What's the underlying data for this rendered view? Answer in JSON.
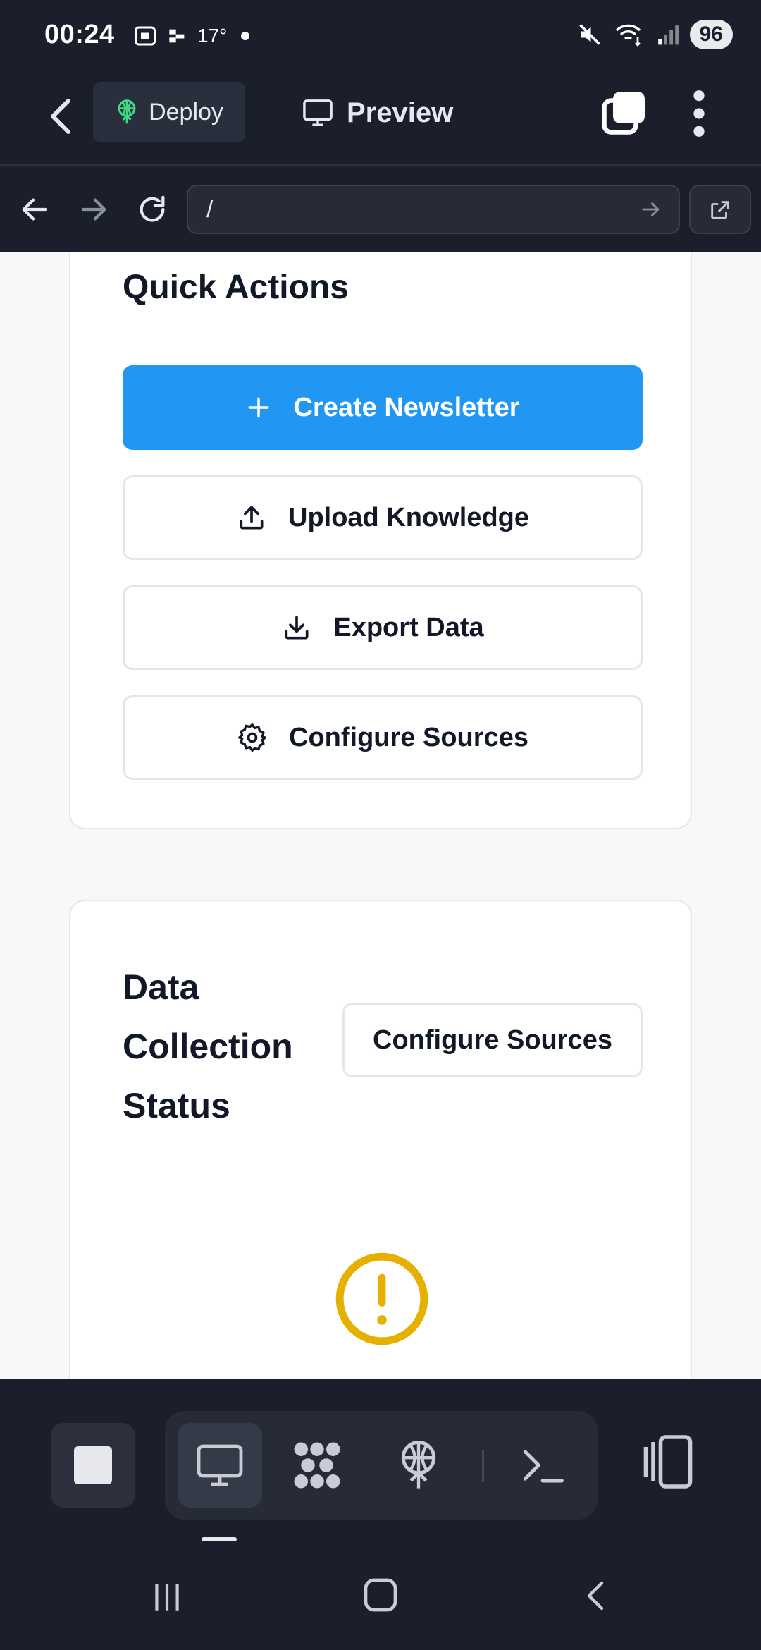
{
  "status_bar": {
    "time": "00:24",
    "temperature": "17°",
    "battery": "96"
  },
  "toolbar": {
    "deploy_label": "Deploy",
    "preview_label": "Preview"
  },
  "url_bar": {
    "value": "/"
  },
  "quick_actions": {
    "title": "Quick Actions",
    "buttons": [
      {
        "label": "Create Newsletter",
        "icon": "plus-icon"
      },
      {
        "label": "Upload Knowledge",
        "icon": "upload-icon"
      },
      {
        "label": "Export Data",
        "icon": "download-icon"
      },
      {
        "label": "Configure Sources",
        "icon": "gear-icon"
      }
    ]
  },
  "data_collection": {
    "title": "Data Collection Status",
    "configure_label": "Configure Sources",
    "status_icon": "warning-icon"
  },
  "dock": {
    "items": [
      "stop-icon",
      "desktop-icon",
      "nodes-icon",
      "deploy-icon",
      "terminal-icon",
      "split-view-icon"
    ]
  },
  "colors": {
    "primary": "#2196f3",
    "dark_bg": "#1b1f2b",
    "warning": "#e6b000",
    "deploy_green": "#3ddc84"
  }
}
